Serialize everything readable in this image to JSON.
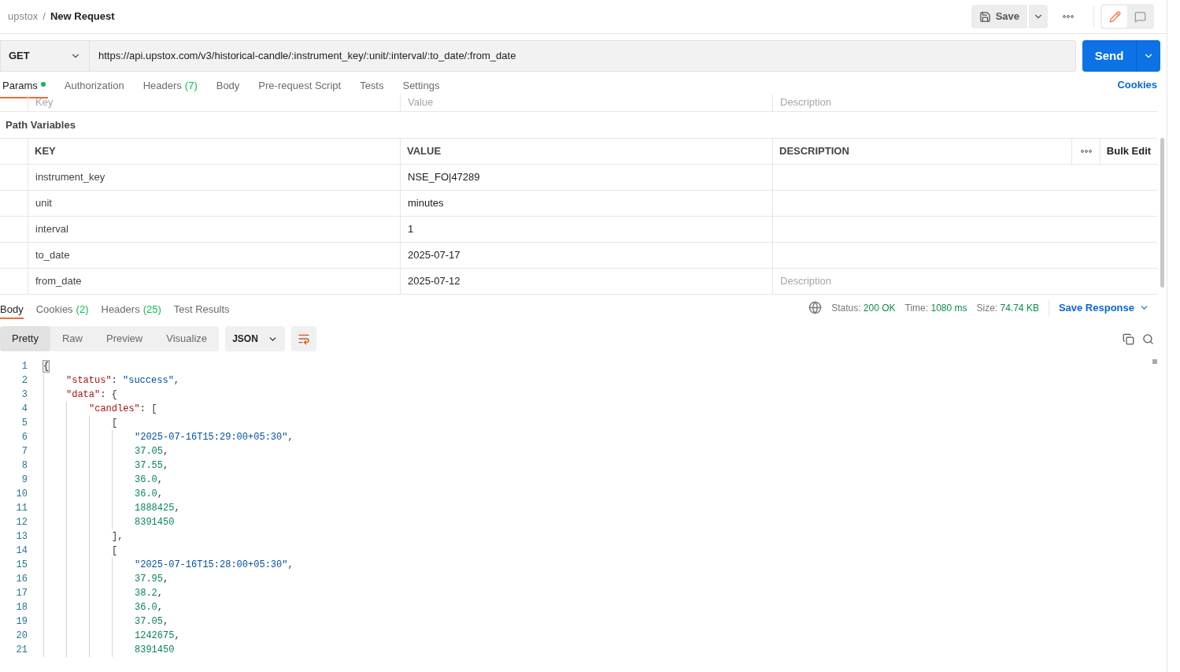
{
  "breadcrumb": {
    "workspace": "upstox",
    "separator": "/",
    "request": "New Request"
  },
  "toolbar": {
    "save": "Save",
    "mode": [
      {
        "kind": "edit",
        "selected": true
      },
      {
        "kind": "comments",
        "selected": false
      }
    ]
  },
  "request": {
    "method": "GET",
    "url": "https://api.upstox.com/v3/historical-candle/:instrument_key/:unit/:interval/:to_date/:from_date",
    "send": "Send"
  },
  "request_tabs": [
    {
      "label": "Params",
      "indicator": true,
      "selected": true
    },
    {
      "label": "Authorization",
      "indicator": false,
      "selected": false
    },
    {
      "label": "Headers",
      "count": "(7)",
      "indicator": false,
      "selected": false
    },
    {
      "label": "Body",
      "indicator": false,
      "selected": false
    },
    {
      "label": "Pre-request Script",
      "indicator": false,
      "selected": false
    },
    {
      "label": "Tests",
      "indicator": false,
      "selected": false
    },
    {
      "label": "Settings",
      "indicator": false,
      "selected": false
    }
  ],
  "cookies_link": "Cookies",
  "query_params": {
    "placeholders": [
      "Key",
      "Value",
      "Description"
    ]
  },
  "path_variables": {
    "title": "Path Variables",
    "columns": [
      "KEY",
      "VALUE",
      "DESCRIPTION"
    ],
    "bulk_edit": "Bulk Edit",
    "rows": [
      {
        "key": "instrument_key",
        "value": "NSE_FO|47289"
      },
      {
        "key": "unit",
        "value": "minutes"
      },
      {
        "key": "interval",
        "value": "1"
      },
      {
        "key": "to_date",
        "value": "2025-07-17"
      },
      {
        "key": "from_date",
        "value": "2025-07-12",
        "description_placeholder": "Description"
      }
    ]
  },
  "response": {
    "tabs": [
      {
        "label": "Body",
        "selected": true
      },
      {
        "label": "Cookies",
        "count": "(2)",
        "selected": false
      },
      {
        "label": "Headers",
        "count": "(25)",
        "selected": false
      },
      {
        "label": "Test Results",
        "selected": false
      }
    ],
    "meta": [
      {
        "label": "Status:",
        "value": "200 OK"
      },
      {
        "label": "Time:",
        "value": "1080 ms"
      },
      {
        "label": "Size:",
        "value": "74.74 KB"
      }
    ],
    "save_response": "Save Response",
    "view_modes": [
      {
        "label": "Pretty",
        "selected": true
      },
      {
        "label": "Raw",
        "selected": false
      },
      {
        "label": "Preview",
        "selected": false
      },
      {
        "label": "Visualize",
        "selected": false
      }
    ],
    "format": "JSON",
    "lines": [
      {
        "number": "1",
        "tokens": [
          {
            "kind": "bracket",
            "text": "{"
          }
        ],
        "children": [
          {
            "number": "2",
            "tokens": [
              {
                "kind": "key",
                "text": "\"status\""
              },
              {
                "kind": "punct",
                "text": ": "
              },
              {
                "kind": "string",
                "text": "\"success\""
              },
              {
                "kind": "punct",
                "text": ","
              }
            ]
          },
          {
            "number": "3",
            "tokens": [
              {
                "kind": "key",
                "text": "\"data\""
              },
              {
                "kind": "punct",
                "text": ": {"
              }
            ],
            "children": [
              {
                "number": "4",
                "tokens": [
                  {
                    "kind": "key",
                    "text": "\"candles\""
                  },
                  {
                    "kind": "punct",
                    "text": ": ["
                  }
                ],
                "children": [
                  {
                    "number": "5",
                    "tokens": [
                      {
                        "kind": "punct",
                        "text": "["
                      }
                    ],
                    "children": [
                      {
                        "number": "6",
                        "tokens": [
                          {
                            "kind": "string",
                            "text": "\"2025-07-16T15:29:00+05:30\""
                          },
                          {
                            "kind": "punct",
                            "text": ","
                          }
                        ]
                      },
                      {
                        "number": "7",
                        "tokens": [
                          {
                            "kind": "number",
                            "text": "37.05"
                          },
                          {
                            "kind": "punct",
                            "text": ","
                          }
                        ]
                      },
                      {
                        "number": "8",
                        "tokens": [
                          {
                            "kind": "number",
                            "text": "37.55"
                          },
                          {
                            "kind": "punct",
                            "text": ","
                          }
                        ]
                      },
                      {
                        "number": "9",
                        "tokens": [
                          {
                            "kind": "number",
                            "text": "36.0"
                          },
                          {
                            "kind": "punct",
                            "text": ","
                          }
                        ]
                      },
                      {
                        "number": "10",
                        "tokens": [
                          {
                            "kind": "number",
                            "text": "36.0"
                          },
                          {
                            "kind": "punct",
                            "text": ","
                          }
                        ]
                      },
                      {
                        "number": "11",
                        "tokens": [
                          {
                            "kind": "number",
                            "text": "1888425"
                          },
                          {
                            "kind": "punct",
                            "text": ","
                          }
                        ]
                      },
                      {
                        "number": "12",
                        "tokens": [
                          {
                            "kind": "number",
                            "text": "8391450"
                          }
                        ]
                      }
                    ]
                  },
                  {
                    "number": "13",
                    "tokens": [
                      {
                        "kind": "punct",
                        "text": "],"
                      }
                    ]
                  },
                  {
                    "number": "14",
                    "tokens": [
                      {
                        "kind": "punct",
                        "text": "["
                      }
                    ],
                    "children": [
                      {
                        "number": "15",
                        "tokens": [
                          {
                            "kind": "string",
                            "text": "\"2025-07-16T15:28:00+05:30\""
                          },
                          {
                            "kind": "punct",
                            "text": ","
                          }
                        ]
                      },
                      {
                        "number": "16",
                        "tokens": [
                          {
                            "kind": "number",
                            "text": "37.95"
                          },
                          {
                            "kind": "punct",
                            "text": ","
                          }
                        ]
                      },
                      {
                        "number": "17",
                        "tokens": [
                          {
                            "kind": "number",
                            "text": "38.2"
                          },
                          {
                            "kind": "punct",
                            "text": ","
                          }
                        ]
                      },
                      {
                        "number": "18",
                        "tokens": [
                          {
                            "kind": "number",
                            "text": "36.0"
                          },
                          {
                            "kind": "punct",
                            "text": ","
                          }
                        ]
                      },
                      {
                        "number": "19",
                        "tokens": [
                          {
                            "kind": "number",
                            "text": "37.05"
                          },
                          {
                            "kind": "punct",
                            "text": ","
                          }
                        ]
                      },
                      {
                        "number": "20",
                        "tokens": [
                          {
                            "kind": "number",
                            "text": "1242675"
                          },
                          {
                            "kind": "punct",
                            "text": ","
                          }
                        ]
                      },
                      {
                        "number": "21",
                        "tokens": [
                          {
                            "kind": "number",
                            "text": "8391450"
                          }
                        ]
                      }
                    ]
                  }
                ]
              }
            ]
          }
        ]
      }
    ]
  }
}
